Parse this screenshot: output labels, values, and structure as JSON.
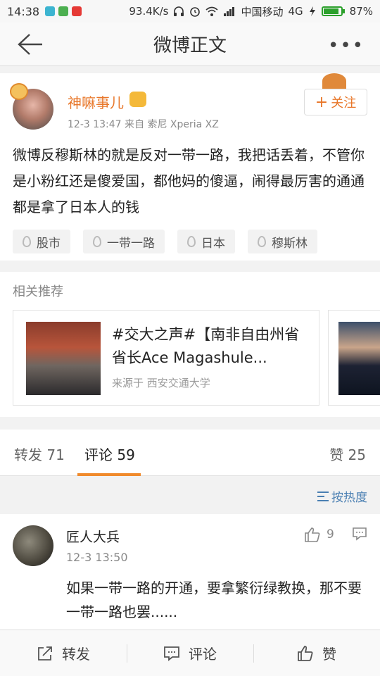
{
  "status_bar": {
    "time": "14:38",
    "network_speed": "93.4K/s",
    "carrier": "中国移动",
    "network_type": "4G",
    "battery": "87%",
    "battery_level": 0.87
  },
  "nav": {
    "title": "微博正文",
    "back_icon": "back-arrow-icon",
    "more_icon": "more-dots-icon"
  },
  "post": {
    "username": "神嘛事儿",
    "meta": "12-3 13:47  来自 索尼 Xperia XZ",
    "follow_label": "关注",
    "content": "微博反穆斯林的就是反对一带一路，我把话丢着，不管你是小粉红还是傻爱国，都他妈的傻逼，闹得最厉害的通通都是拿了日本人的钱",
    "tags": [
      "股市",
      "一带一路",
      "日本",
      "穆斯林"
    ]
  },
  "related": {
    "heading": "相关推荐",
    "card": {
      "title": "#交大之声#【南非自由州省省长Ace Magashule...",
      "source": "来源于 西安交通大学"
    }
  },
  "tabs": {
    "repost": "转发 71",
    "comment": "评论 59",
    "like": "赞 25",
    "active": "comment"
  },
  "sort": {
    "label": "按热度"
  },
  "comment": {
    "name": "匠人大兵",
    "time": "12-3 13:50",
    "likes": "9",
    "text": "如果一带一路的开通，要拿繁衍绿教换，那不要一带一路也罢......"
  },
  "bottom_bar": {
    "repost": "转发",
    "comment": "评论",
    "like": "赞"
  },
  "colors": {
    "accent": "#f08a2c",
    "username": "#e8772a",
    "link": "#4a7fb2",
    "battery": "#2ca02c"
  }
}
